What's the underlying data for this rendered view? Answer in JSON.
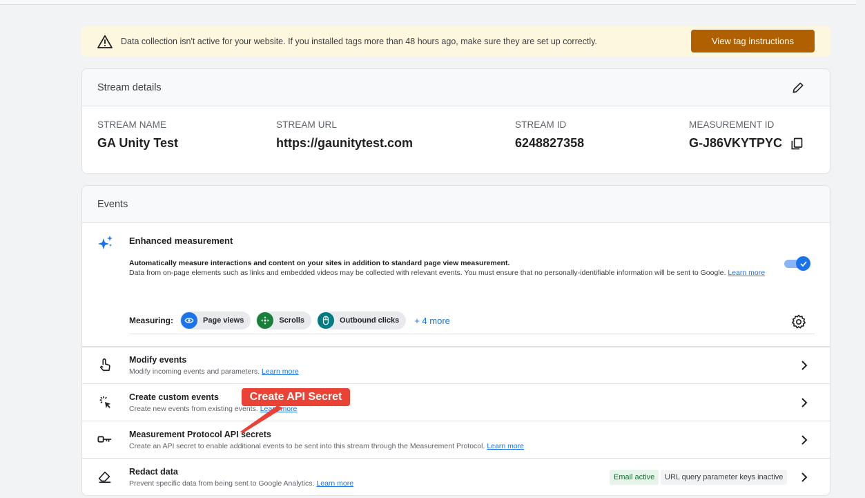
{
  "alert": {
    "message": "Data collection isn't active for your website. If you installed tags more than 48 hours ago, make sure they are set up correctly.",
    "button": "View tag instructions"
  },
  "stream": {
    "title": "Stream details",
    "fields": [
      {
        "label": "STREAM NAME",
        "value": "GA Unity Test"
      },
      {
        "label": "STREAM URL",
        "value": "https://gaunitytest.com"
      },
      {
        "label": "STREAM ID",
        "value": "6248827358"
      },
      {
        "label": "MEASUREMENT ID",
        "value": "G-J86VKYTPYC"
      }
    ]
  },
  "events": {
    "title": "Events",
    "enhanced": {
      "title": "Enhanced measurement",
      "line1": "Automatically measure interactions and content on your sites in addition to standard page view measurement.",
      "line2": "Data from on-page elements such as links and embedded videos may be collected with relevant events. You must ensure that no personally-identifiable information will be sent to Google.",
      "learn_more": "Learn more",
      "enabled": true,
      "measuring_label": "Measuring:",
      "chips": [
        {
          "label": "Page views",
          "color": "#1a73e8"
        },
        {
          "label": "Scrolls",
          "color": "#188038"
        },
        {
          "label": "Outbound clicks",
          "color": "#007b83"
        }
      ],
      "more": "+ 4 more"
    },
    "rows": [
      {
        "title": "Modify events",
        "desc": "Modify incoming events and parameters.",
        "learn_more": "Learn more"
      },
      {
        "title": "Create custom events",
        "desc": "Create new events from existing events.",
        "learn_more": "Learn more"
      },
      {
        "title": "Measurement Protocol API secrets",
        "desc": "Create an API secret to enable additional events to be sent into this stream through the Measurement Protocol.",
        "learn_more": "Learn more"
      },
      {
        "title": "Redact data",
        "desc": "Prevent specific data from being sent to Google Analytics.",
        "learn_more": "Learn more",
        "badges": [
          "Email active",
          "URL query parameter keys inactive"
        ]
      }
    ]
  },
  "callout": {
    "label": "Create API Secret",
    "color": "#ea4335"
  }
}
